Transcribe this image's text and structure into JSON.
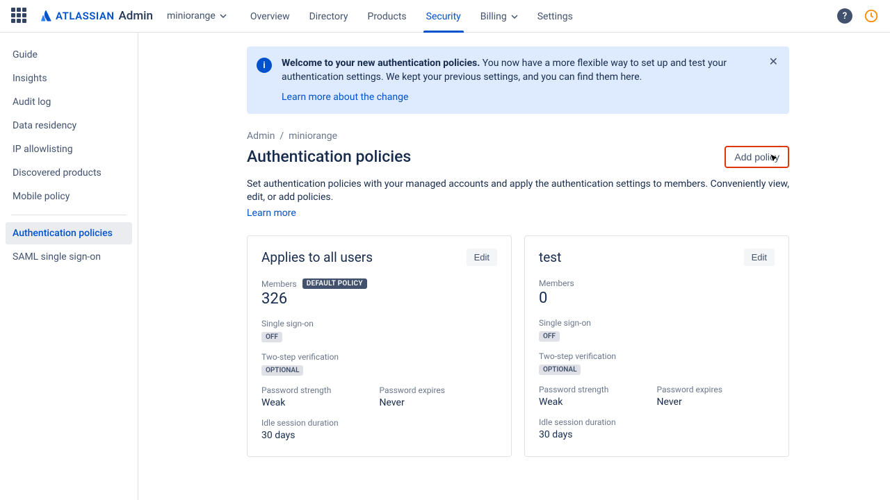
{
  "topbar": {
    "brand": "ATLASSIAN",
    "app": "Admin",
    "org": "miniorange",
    "tabs": [
      "Overview",
      "Directory",
      "Products",
      "Security",
      "Billing",
      "Settings"
    ]
  },
  "sidebar": {
    "group1": [
      "Guide",
      "Insights",
      "Audit log",
      "Data residency",
      "IP allowlisting",
      "Discovered products",
      "Mobile policy"
    ],
    "group2": [
      "Authentication policies",
      "SAML single sign-on"
    ]
  },
  "banner": {
    "title": "Welcome to your new authentication policies.",
    "body": "You now have a more flexible way to set up and test your authentication settings. We kept your previous settings, and you can find them here.",
    "link": "Learn more about the change"
  },
  "breadcrumb": {
    "root": "Admin",
    "leaf": "miniorange"
  },
  "page": {
    "title": "Authentication policies",
    "add_btn": "Add policy",
    "desc": "Set authentication policies with your managed accounts and apply the authentication settings to members. Conveniently view, edit, or add policies.",
    "learn": "Learn more"
  },
  "labels": {
    "members": "Members",
    "default_badge": "DEFAULT POLICY",
    "edit": "Edit",
    "sso": "Single sign-on",
    "twostep": "Two-step verification",
    "pwd_strength": "Password strength",
    "pwd_expires": "Password expires",
    "idle": "Idle session duration"
  },
  "cards": [
    {
      "title": "Applies to all users",
      "members": "326",
      "default": true,
      "sso": "OFF",
      "twostep": "OPTIONAL",
      "pwd_strength": "Weak",
      "pwd_expires": "Never",
      "idle": "30 days"
    },
    {
      "title": "test",
      "members": "0",
      "default": false,
      "sso": "OFF",
      "twostep": "OPTIONAL",
      "pwd_strength": "Weak",
      "pwd_expires": "Never",
      "idle": "30 days"
    }
  ]
}
